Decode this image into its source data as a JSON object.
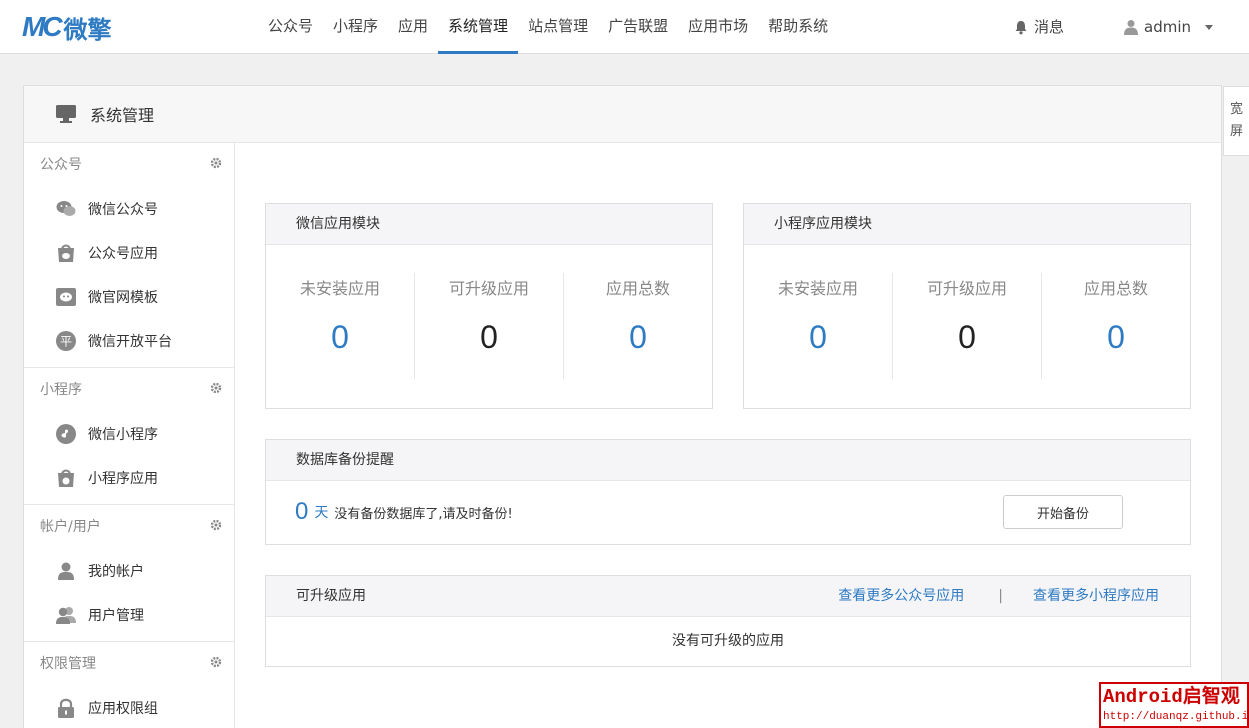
{
  "brand": {
    "mark": "MC",
    "name": "微擎"
  },
  "nav": [
    {
      "label": "公众号"
    },
    {
      "label": "小程序"
    },
    {
      "label": "应用"
    },
    {
      "label": "系统管理",
      "active": true
    },
    {
      "label": "站点管理"
    },
    {
      "label": "广告联盟"
    },
    {
      "label": "应用市场"
    },
    {
      "label": "帮助系统"
    }
  ],
  "header_right": {
    "messages": "消息",
    "user": "admin"
  },
  "wide_toggle": [
    "宽",
    "屏"
  ],
  "panel": {
    "title": "系统管理"
  },
  "sidebar": {
    "groups": [
      {
        "title": "公众号",
        "items": [
          {
            "label": "微信公众号",
            "icon": "wechat-icon"
          },
          {
            "label": "公众号应用",
            "icon": "app-bag-icon"
          },
          {
            "label": "微官网模板",
            "icon": "template-icon"
          },
          {
            "label": "微信开放平台",
            "icon": "platform-icon"
          }
        ]
      },
      {
        "title": "小程序",
        "items": [
          {
            "label": "微信小程序",
            "icon": "miniprogram-icon"
          },
          {
            "label": "小程序应用",
            "icon": "miniprogram-app-icon"
          }
        ]
      },
      {
        "title": "帐户/用户",
        "items": [
          {
            "label": "我的帐户",
            "icon": "user-icon"
          },
          {
            "label": "用户管理",
            "icon": "users-icon"
          }
        ]
      },
      {
        "title": "权限管理",
        "items": [
          {
            "label": "应用权限组",
            "icon": "lock-icon"
          }
        ]
      }
    ]
  },
  "wechat_module": {
    "title": "微信应用模块",
    "stats": [
      {
        "label": "未安装应用",
        "value": "0",
        "color": "#2e7bc4"
      },
      {
        "label": "可升级应用",
        "value": "0",
        "color": "#222222"
      },
      {
        "label": "应用总数",
        "value": "0",
        "color": "#2e7bc4"
      }
    ]
  },
  "mini_module": {
    "title": "小程序应用模块",
    "stats": [
      {
        "label": "未安装应用",
        "value": "0",
        "color": "#2e7bc4"
      },
      {
        "label": "可升级应用",
        "value": "0",
        "color": "#222222"
      },
      {
        "label": "应用总数",
        "value": "0",
        "color": "#2e7bc4"
      }
    ]
  },
  "backup": {
    "title": "数据库备份提醒",
    "days": "0",
    "unit": "天",
    "message": "没有备份数据库了,请及时备份!",
    "button": "开始备份"
  },
  "upgradable": {
    "title": "可升级应用",
    "link_official": "查看更多公众号应用",
    "separator": "|",
    "link_mini": "查看更多小程序应用",
    "empty": "没有可升级的应用"
  },
  "watermark": {
    "line1": "Android启智观",
    "line2": "http://duanqz.github.io"
  },
  "colors": {
    "accent": "#2e7bc4",
    "border": "#dddddd",
    "background": "#f0f0f0"
  }
}
